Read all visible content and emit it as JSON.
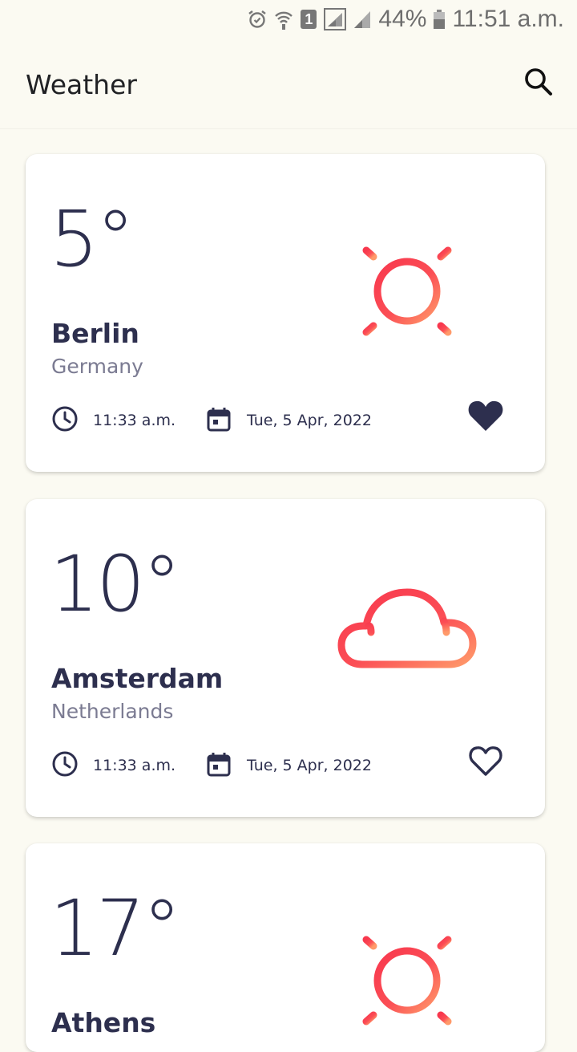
{
  "status_bar": {
    "battery": "44%",
    "time": "11:51 a.m.",
    "sim_slot": "1",
    "icons": [
      "alarm-icon",
      "wifi-icon",
      "sim-icon",
      "signal-icon",
      "battery-icon"
    ]
  },
  "app_bar": {
    "title": "Weather",
    "search_icon": "search-icon"
  },
  "colors": {
    "background": "#fbfaf2",
    "text_primary": "#2d2f4e",
    "text_secondary": "#7b7b92",
    "icon_gradient_start": "#f8384e",
    "icon_gradient_end": "#ff9a6a"
  },
  "cards": [
    {
      "temperature": "5°",
      "city": "Berlin",
      "country": "Germany",
      "time": "11:33 a.m.",
      "date": "Tue, 5 Apr, 2022",
      "weather_icon": "sun-icon",
      "favorite": true
    },
    {
      "temperature": "10°",
      "city": "Amsterdam",
      "country": "Netherlands",
      "time": "11:33 a.m.",
      "date": "Tue, 5 Apr, 2022",
      "weather_icon": "cloud-icon",
      "favorite": false
    },
    {
      "temperature": "17°",
      "city": "Athens",
      "country": "",
      "time": "",
      "date": "",
      "weather_icon": "sun-icon",
      "favorite": false
    }
  ]
}
